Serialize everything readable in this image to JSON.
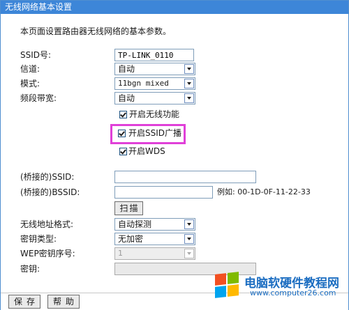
{
  "window": {
    "title": "无线网络基本设置"
  },
  "intro": "本页面设置路由器无线网络的基本参数。",
  "fields": {
    "ssid": {
      "label": "SSID号:",
      "value": "TP-LINK_0110"
    },
    "channel": {
      "label": "信道:",
      "value": "自动"
    },
    "mode": {
      "label": "模式:",
      "value": "11bgn mixed"
    },
    "bandwidth": {
      "label": "频段带宽:",
      "value": "自动"
    }
  },
  "checkboxes": {
    "enable_wireless": {
      "label": "开启无线功能",
      "checked": true
    },
    "enable_ssid_broadcast": {
      "label": "开启SSID广播",
      "checked": true
    },
    "enable_wds": {
      "label": "开启WDS",
      "checked": true
    }
  },
  "wds": {
    "bridged_ssid": {
      "label": "(桥接的)SSID:",
      "value": ""
    },
    "bridged_bssid": {
      "label": "(桥接的)BSSID:",
      "value": "",
      "example": "例如: 00-1D-0F-11-22-33"
    },
    "scan_label": "扫描",
    "address_format": {
      "label": "无线地址格式:",
      "value": "自动探测"
    },
    "key_type": {
      "label": "密钥类型:",
      "value": "无加密"
    },
    "wep_index": {
      "label": "WEP密钥序号:",
      "value": "1"
    },
    "key": {
      "label": "密钥:",
      "value": ""
    }
  },
  "footer": {
    "save_label": "保存",
    "help_label": "帮助"
  },
  "watermark": {
    "title": "电脑软硬件教程网",
    "url": "www.computer26.com"
  },
  "colors": {
    "titlebar": "#3d86d8",
    "highlight": "#e040d8",
    "watermark": "#1b6dc1"
  }
}
